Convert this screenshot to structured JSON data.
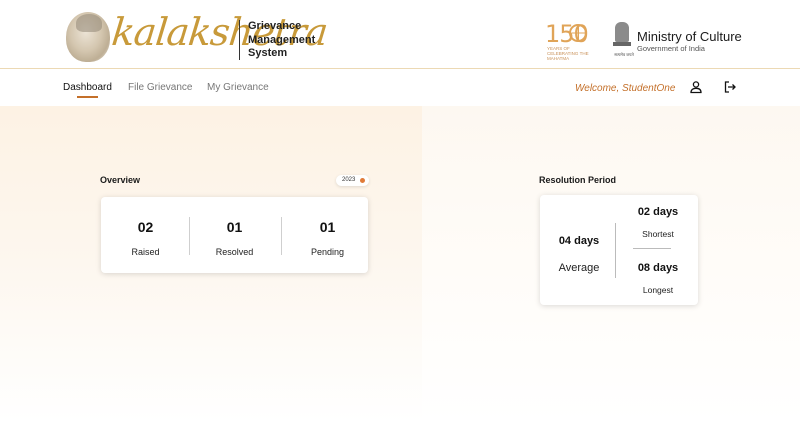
{
  "header": {
    "logo_text": "kalakshetra",
    "app_title_lines": [
      "Grievance",
      "Management",
      "System"
    ],
    "anniversary": {
      "number": "150",
      "caption": "YEARS OF CELEBRATING THE MAHATMA"
    },
    "emblem_motto": "सत्यमेव जयते",
    "ministry_title": "Ministry of Culture",
    "ministry_subtitle": "Government of India"
  },
  "nav": {
    "items": [
      {
        "label": "Dashboard",
        "active": true
      },
      {
        "label": "File Grievance",
        "active": false
      },
      {
        "label": "My Grievance",
        "active": false
      }
    ],
    "welcome": "Welcome, StudentOne",
    "icons": [
      "user-icon",
      "logout-icon"
    ]
  },
  "overview": {
    "title": "Overview",
    "year": "2023",
    "stats": [
      {
        "value": "02",
        "label": "Raised"
      },
      {
        "value": "01",
        "label": "Resolved"
      },
      {
        "value": "01",
        "label": "Pending"
      }
    ]
  },
  "resolution": {
    "title": "Resolution Period",
    "average": {
      "value": "04 days",
      "label": "Average"
    },
    "shortest": {
      "value": "02 days",
      "label": "Shortest"
    },
    "longest": {
      "value": "08 days",
      "label": "Longest"
    }
  },
  "colors": {
    "accent": "#c4702a",
    "gold": "#c89a3a",
    "badge_dot": "#e07b39"
  }
}
